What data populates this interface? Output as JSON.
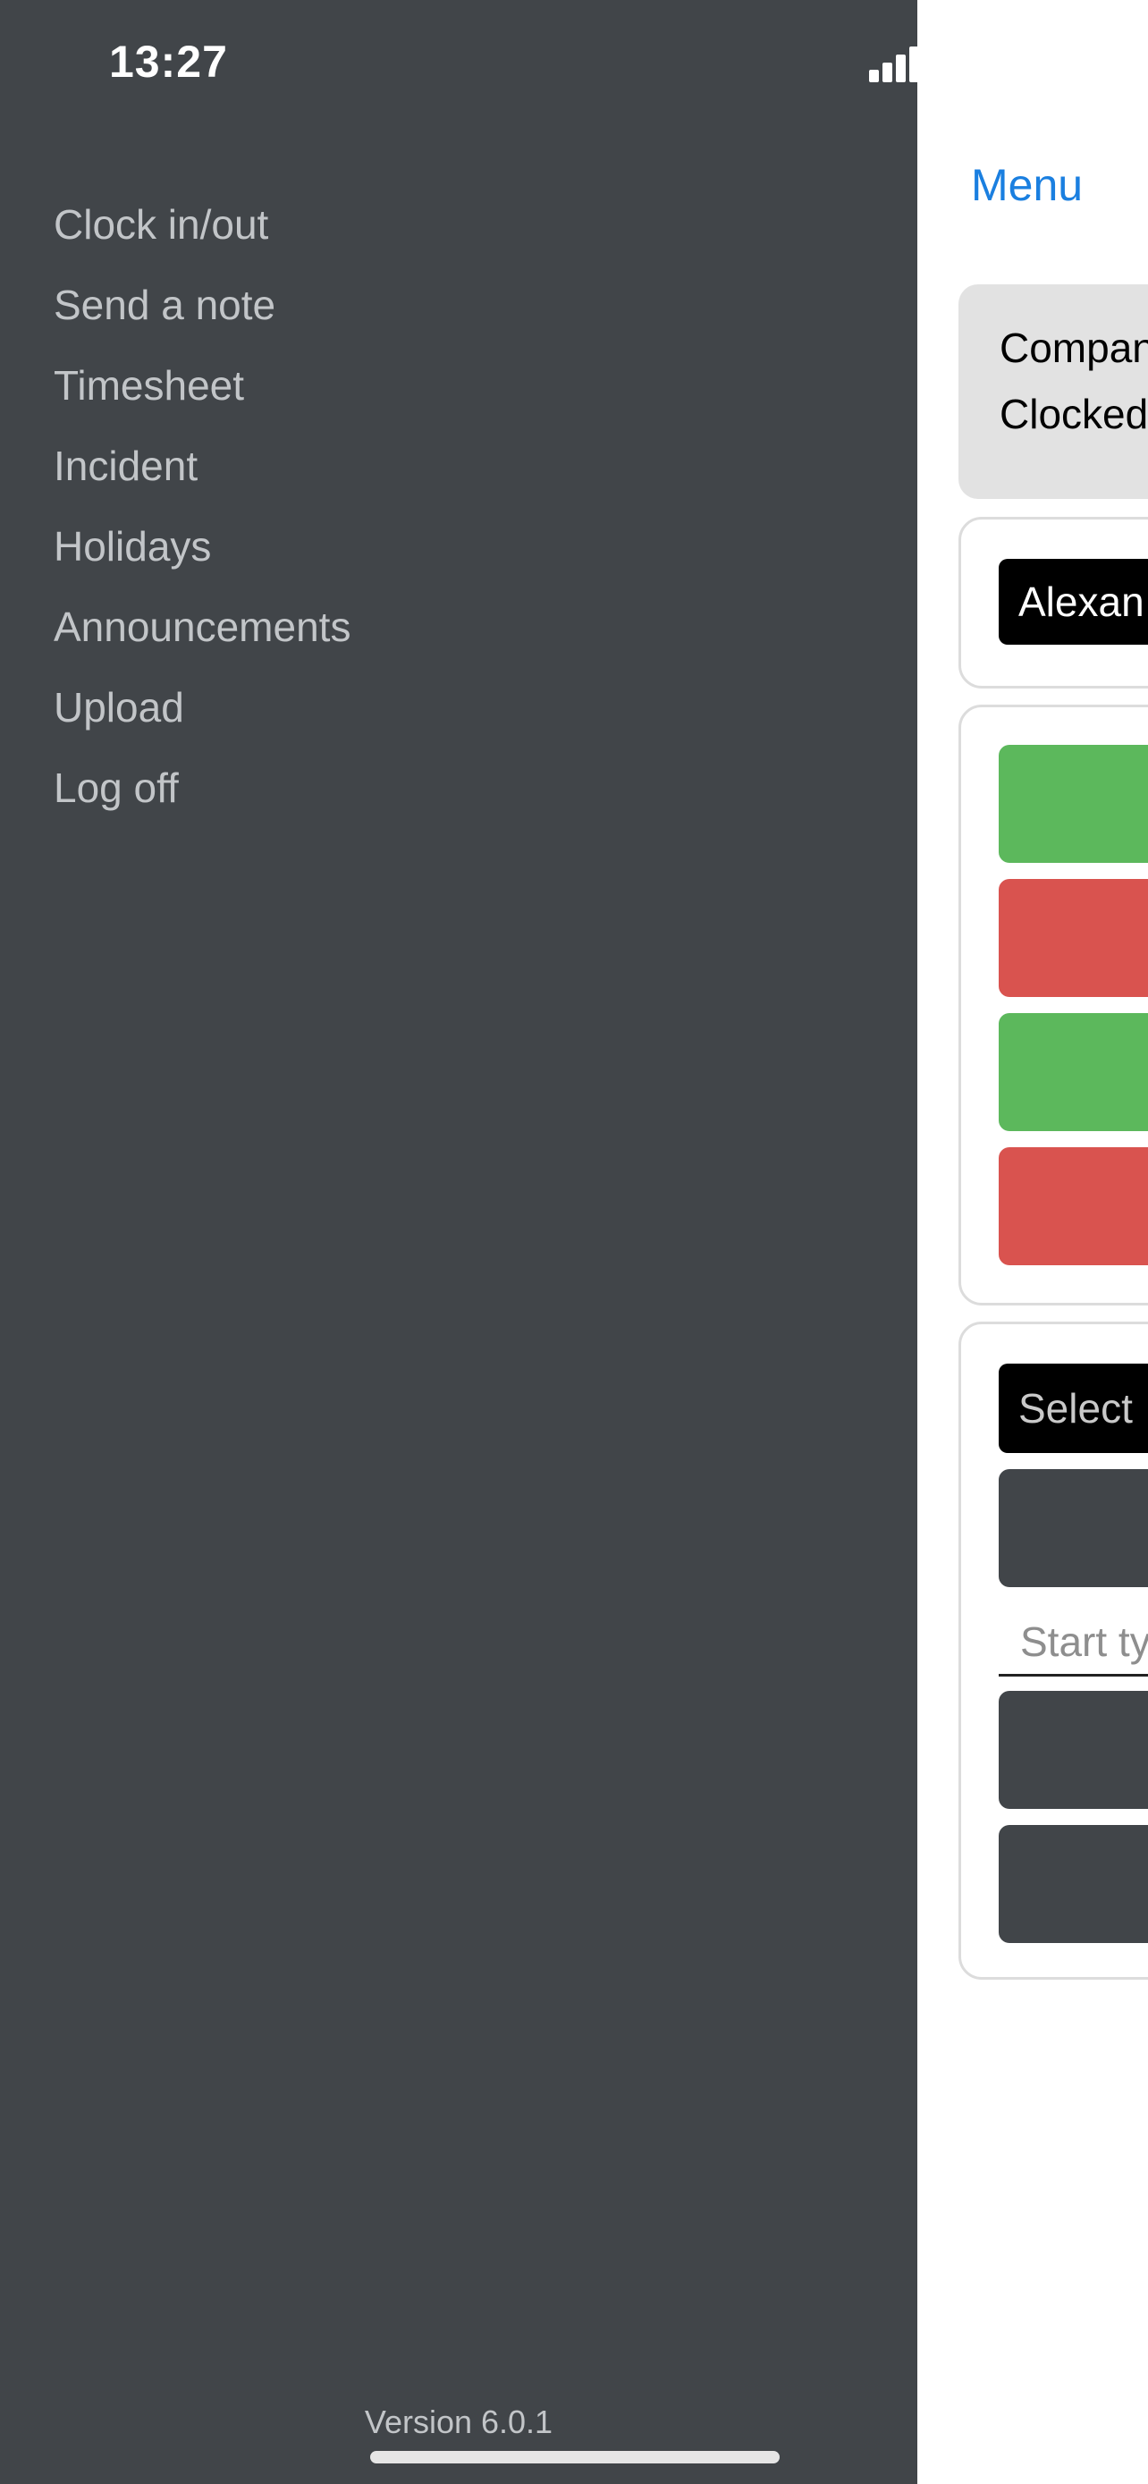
{
  "status_bar": {
    "time": "13:27"
  },
  "drawer": {
    "items": [
      {
        "label": "Clock in/out"
      },
      {
        "label": "Send a note"
      },
      {
        "label": "Timesheet"
      },
      {
        "label": "Incident"
      },
      {
        "label": "Holidays"
      },
      {
        "label": "Announcements"
      },
      {
        "label": "Upload"
      },
      {
        "label": "Log off"
      }
    ],
    "version": "Version 6.0.1"
  },
  "main": {
    "menu_label": "Menu",
    "info": {
      "line1": "Compan",
      "line2": "Clocked"
    },
    "name_value": "Alexan",
    "select_placeholder": "Select",
    "search_placeholder": "Start ty"
  },
  "colors": {
    "drawer_bg": "#414549",
    "accent_link": "#1a7fe0",
    "success": "#5cb85c",
    "danger": "#d9534f"
  }
}
